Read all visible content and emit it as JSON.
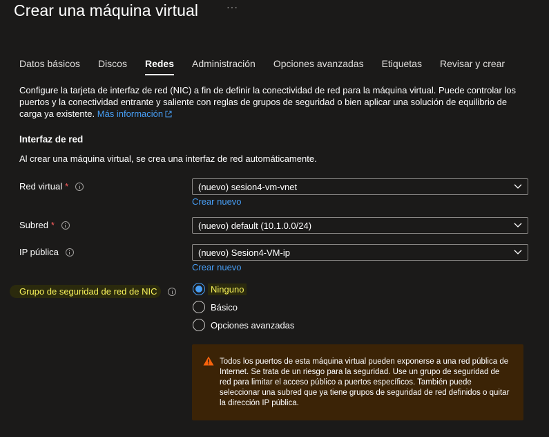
{
  "header": {
    "title": "Crear una máquina virtual",
    "more": "···"
  },
  "tabs": [
    {
      "label": "Datos básicos",
      "active": false
    },
    {
      "label": "Discos",
      "active": false
    },
    {
      "label": "Redes",
      "active": true
    },
    {
      "label": "Administración",
      "active": false
    },
    {
      "label": "Opciones avanzadas",
      "active": false
    },
    {
      "label": "Etiquetas",
      "active": false
    },
    {
      "label": "Revisar y crear",
      "active": false
    }
  ],
  "description": {
    "text": "Configure la tarjeta de interfaz de red (NIC) a fin de definir la conectividad de red para la máquina virtual. Puede controlar los puertos y la conectividad entrante y saliente con reglas de grupos de seguridad o bien aplicar una solución de equilibrio de carga ya existente.",
    "link": "Más información"
  },
  "section": {
    "title": "Interfaz de red",
    "description": "Al crear una máquina virtual, se crea una interfaz de red automáticamente."
  },
  "fields": {
    "vnet": {
      "label": "Red virtual",
      "required": "*",
      "value": "(nuevo) sesion4-vm-vnet",
      "create_link": "Crear nuevo"
    },
    "subnet": {
      "label": "Subred",
      "required": "*",
      "value": "(nuevo) default (10.1.0.0/24)"
    },
    "public_ip": {
      "label": "IP pública",
      "value": "(nuevo) Sesion4-VM-ip",
      "create_link": "Crear nuevo"
    },
    "nsg": {
      "label": "Grupo de seguridad de red de NIC",
      "options": [
        "Ninguno",
        "Básico",
        "Opciones avanzadas"
      ],
      "selected": "Ninguno"
    }
  },
  "warning": {
    "text": "Todos los puertos de esta máquina virtual pueden exponerse a una red pública de Internet. Se trata de un riesgo para la seguridad. Use un grupo de seguridad de red para limitar el acceso público a puertos específicos. También puede seleccionar una subred que ya tiene grupos de seguridad de red definidos o quitar la dirección IP pública."
  },
  "colors": {
    "background": "#1b1a19",
    "link": "#479ef5",
    "highlight": "#f7f25a",
    "required": "#ff5f5f",
    "warning_bg": "#3b2306",
    "warning_icon": "#f7630c"
  }
}
